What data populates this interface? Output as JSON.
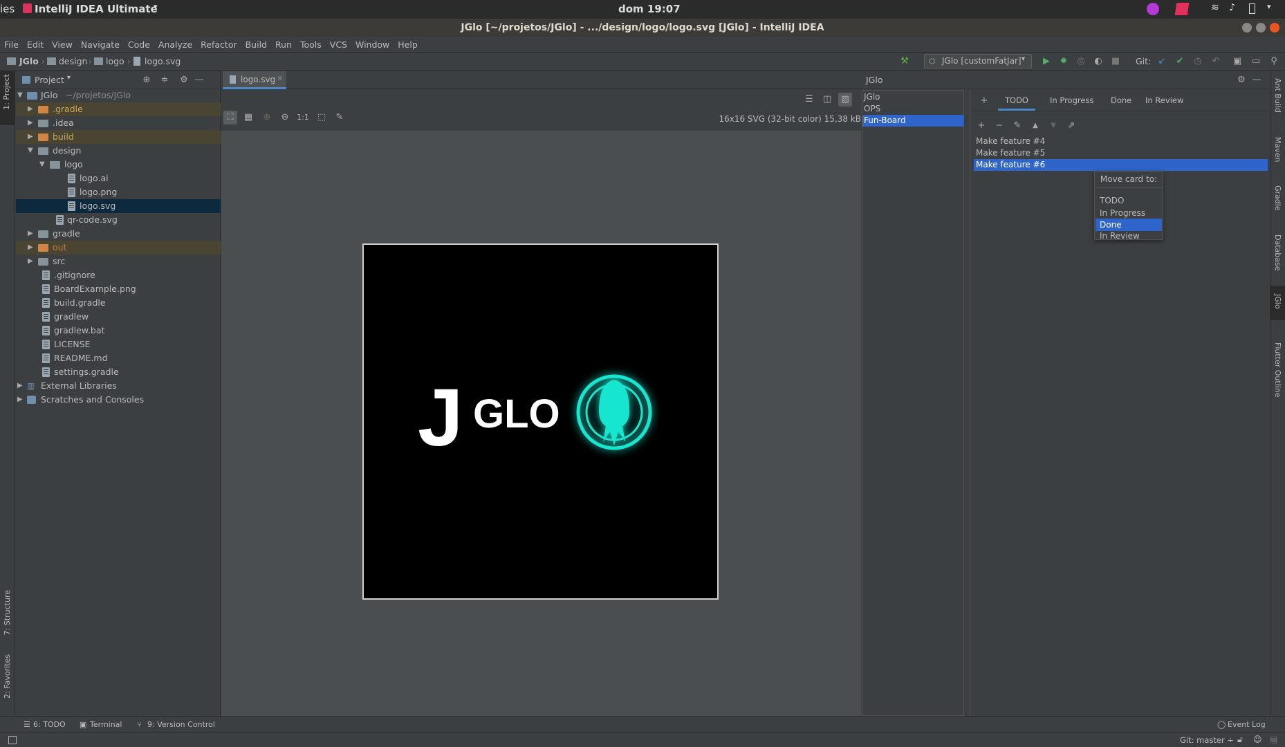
{
  "system": {
    "activities": "ies",
    "app_name": "IntelliJ IDEA Ultimate",
    "clock": "dom 19:07"
  },
  "window": {
    "title": "JGlo [~/projetos/JGlo] - .../design/logo/logo.svg [JGlo] - IntelliJ IDEA"
  },
  "menu": [
    "File",
    "Edit",
    "View",
    "Navigate",
    "Code",
    "Analyze",
    "Refactor",
    "Build",
    "Run",
    "Tools",
    "VCS",
    "Window",
    "Help"
  ],
  "breadcrumb": [
    "JGlo",
    "design",
    "logo",
    "logo.svg"
  ],
  "toolbar": {
    "run_config": "JGlo [customFatJar]",
    "git_label": "Git:"
  },
  "left_strip": {
    "project": "1: Project",
    "structure": "7: Structure",
    "favorites": "2: Favorites"
  },
  "right_strip": [
    "Ant Build",
    "Maven",
    "Gradle",
    "Database",
    "JGlo",
    "Flutter Outline"
  ],
  "project_panel": {
    "title": "Project",
    "root_name": "JGlo",
    "root_path": "~/projetos/JGlo",
    "items": [
      ".gradle",
      ".idea",
      "build",
      "design",
      "logo",
      "logo.ai",
      "logo.png",
      "logo.svg",
      "qr-code.svg",
      "gradle",
      "out",
      "src",
      ".gitignore",
      "BoardExample.png",
      "build.gradle",
      "gradlew",
      "gradlew.bat",
      "LICENSE",
      "README.md",
      "settings.gradle",
      "External Libraries",
      "Scratches and Consoles"
    ]
  },
  "editor": {
    "tab": "logo.svg",
    "zoom_label": "1:1",
    "image_info": "16x16 SVG (32-bit color) 15,38 kB",
    "logo_j": "J",
    "logo_glo": "GLO"
  },
  "jglo_panel": {
    "title": "JGlo",
    "boards": [
      "JGlo",
      "OPS",
      "Fun-Board"
    ],
    "tabs": [
      "TODO",
      "In Progress",
      "Done",
      "In Review"
    ],
    "cards": [
      "Make feature #4",
      "Make feature #5",
      "Make feature #6"
    ],
    "popup_title": "Move card to:",
    "popup_options": [
      "TODO",
      "In Progress",
      "Done",
      "In Review"
    ]
  },
  "bottom_tools": {
    "todo": "6: TODO",
    "terminal": "Terminal",
    "vcs": "9: Version Control",
    "event_log": "Event Log"
  },
  "status": {
    "git_branch": "Git: master ÷"
  },
  "colors": {
    "selection": "#2f65ca",
    "glo_accent": "#18e6d0",
    "tree_selection": "#0d293e"
  }
}
